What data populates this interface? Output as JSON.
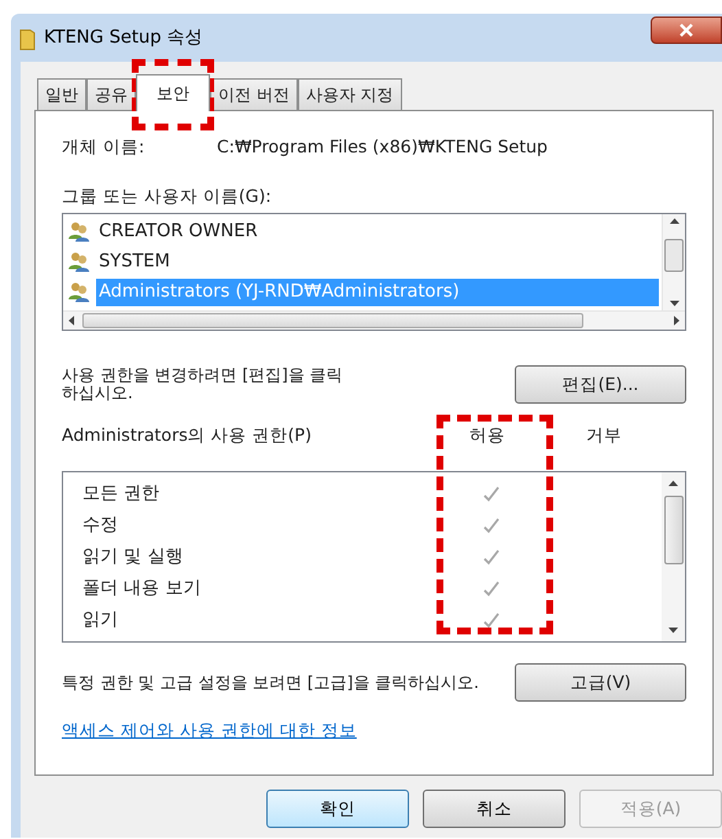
{
  "window": {
    "title": "KTENG Setup 속성"
  },
  "tabs": [
    {
      "label": "일반",
      "selected": false
    },
    {
      "label": "공유",
      "selected": false
    },
    {
      "label": "보안",
      "selected": true
    },
    {
      "label": "이전 버전",
      "selected": false
    },
    {
      "label": "사용자 지정",
      "selected": false
    }
  ],
  "object_name": {
    "label": "개체 이름:",
    "value": "C:₩Program Files (x86)₩KTENG Setup"
  },
  "users": {
    "label": "그룹 또는 사용자 이름(G):",
    "items": [
      {
        "name": "CREATOR OWNER",
        "selected": false
      },
      {
        "name": "SYSTEM",
        "selected": false
      },
      {
        "name": "Administrators (YJ-RND₩Administrators)",
        "selected": true
      }
    ]
  },
  "edit_hint": "사용 권한을 변경하려면 [편집]을 클릭하십시오.",
  "edit_button": "편집(E)...",
  "permissions": {
    "label": "Administrators의 사용 권한(P)",
    "allow_header": "허용",
    "deny_header": "거부",
    "rows": [
      {
        "name": "모든 권한",
        "allow": true,
        "deny": false
      },
      {
        "name": "수정",
        "allow": true,
        "deny": false
      },
      {
        "name": "읽기 및 실행",
        "allow": true,
        "deny": false
      },
      {
        "name": "폴더 내용 보기",
        "allow": true,
        "deny": false
      },
      {
        "name": "읽기",
        "allow": true,
        "deny": false
      }
    ]
  },
  "advanced_hint": "특정 권한 및 고급 설정을 보려면 [고급]을 클릭하십시오.",
  "advanced_button": "고급(V)",
  "help_link": "액세스 제어와 사용 권한에 대한 정보",
  "buttons": [
    {
      "label": "확인",
      "disabled": false,
      "default": true
    },
    {
      "label": "취소",
      "disabled": false,
      "default": false
    },
    {
      "label": "적용(A)",
      "disabled": true,
      "default": false
    }
  ]
}
